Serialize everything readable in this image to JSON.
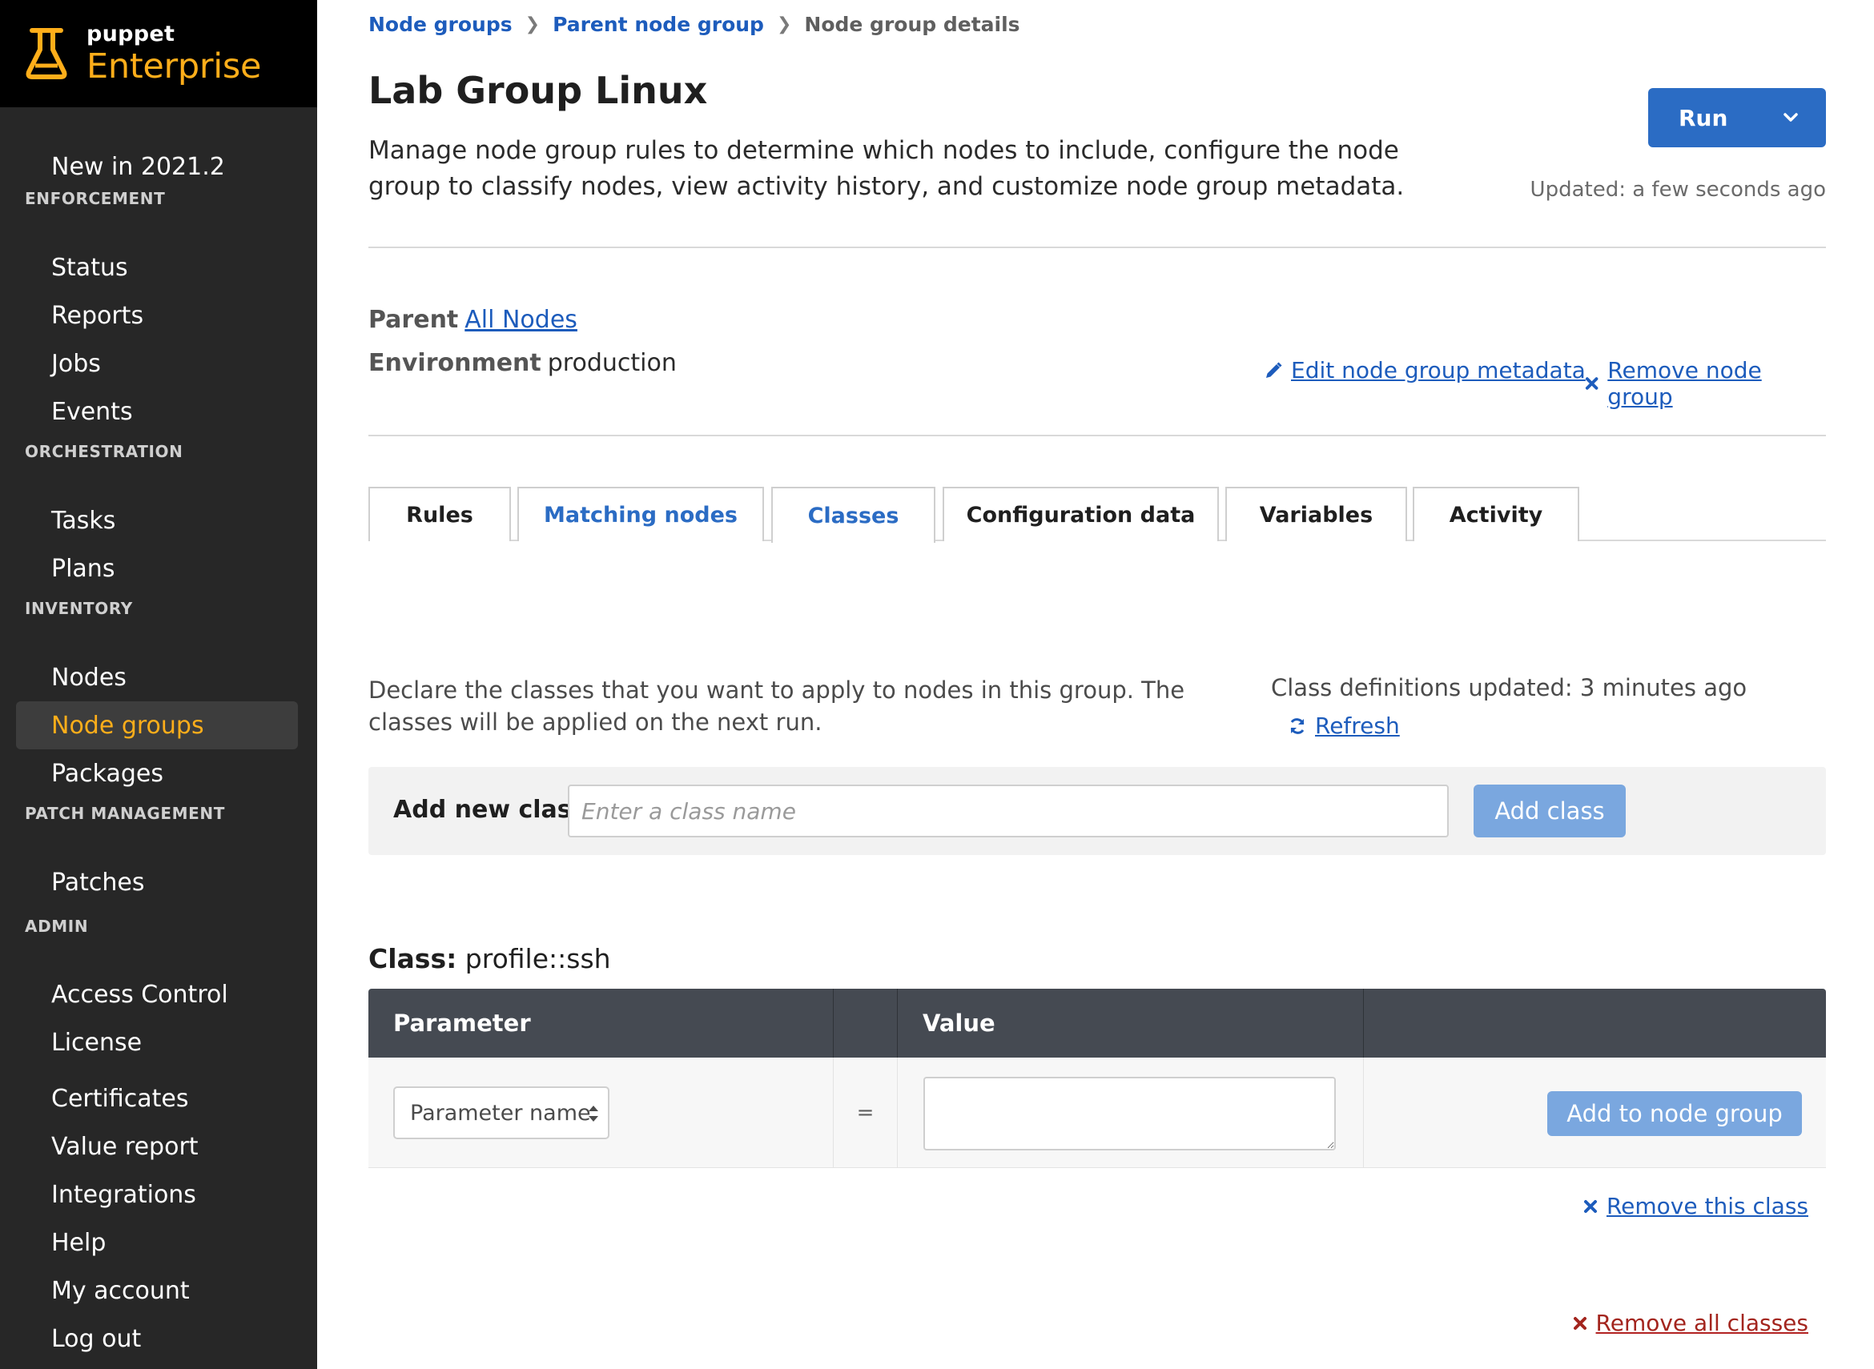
{
  "brand": {
    "small": "puppet",
    "big": "Enterprise"
  },
  "sidebar": {
    "top_item": "New in 2021.2",
    "sections": [
      {
        "title": "ENFORCEMENT",
        "items": [
          "Status",
          "Reports",
          "Jobs",
          "Events"
        ]
      },
      {
        "title": "ORCHESTRATION",
        "items": [
          "Tasks",
          "Plans"
        ]
      },
      {
        "title": "INVENTORY",
        "items": [
          "Nodes",
          "Node groups",
          "Packages"
        ]
      },
      {
        "title": "PATCH MANAGEMENT",
        "items": [
          "Patches"
        ]
      },
      {
        "title": "ADMIN",
        "items": [
          "Access Control",
          "License",
          "Certificates",
          "Value report",
          "Integrations",
          "Help",
          "My account",
          "Log out"
        ]
      }
    ],
    "active_item": "Node groups"
  },
  "breadcrumb": {
    "items": [
      "Node groups",
      "Parent node group"
    ],
    "current": "Node group details"
  },
  "header": {
    "title": "Lab Group Linux",
    "description": "Manage node group rules to determine which nodes to include, configure the node group to classify nodes, view activity history, and customize node group metadata.",
    "run_label": "Run",
    "updated": "Updated: a few seconds ago"
  },
  "meta": {
    "parent_label": "Parent",
    "parent_value": "All Nodes",
    "env_label": "Environment",
    "env_value": "production",
    "edit_link": "Edit node group metadata",
    "remove_link": "Remove node group"
  },
  "tabs": [
    "Rules",
    "Matching nodes",
    "Classes",
    "Configuration data",
    "Variables",
    "Activity"
  ],
  "active_tab": "Classes",
  "classes": {
    "description": "Declare the classes that you want to apply to nodes in this group. The classes will be applied on the next run.",
    "definitions_updated": "Class definitions updated: 3 minutes ago",
    "refresh": "Refresh",
    "add_label": "Add new class",
    "input_placeholder": "Enter a class name",
    "add_button": "Add class",
    "class_prefix": "Class:",
    "class_name": "profile::ssh",
    "table": {
      "headers": [
        "Parameter",
        "",
        "Value",
        ""
      ],
      "param_placeholder": "Parameter name",
      "equals": "=",
      "add_button": "Add to node group"
    },
    "remove_class": "Remove this class",
    "remove_all": "Remove all classes"
  },
  "colors": {
    "brand_orange": "#ffae1a",
    "primary_blue": "#2b6cc4",
    "disabled_blue": "#7aa7df",
    "sidebar_bg": "#272727",
    "danger_red": "#a3251e"
  }
}
